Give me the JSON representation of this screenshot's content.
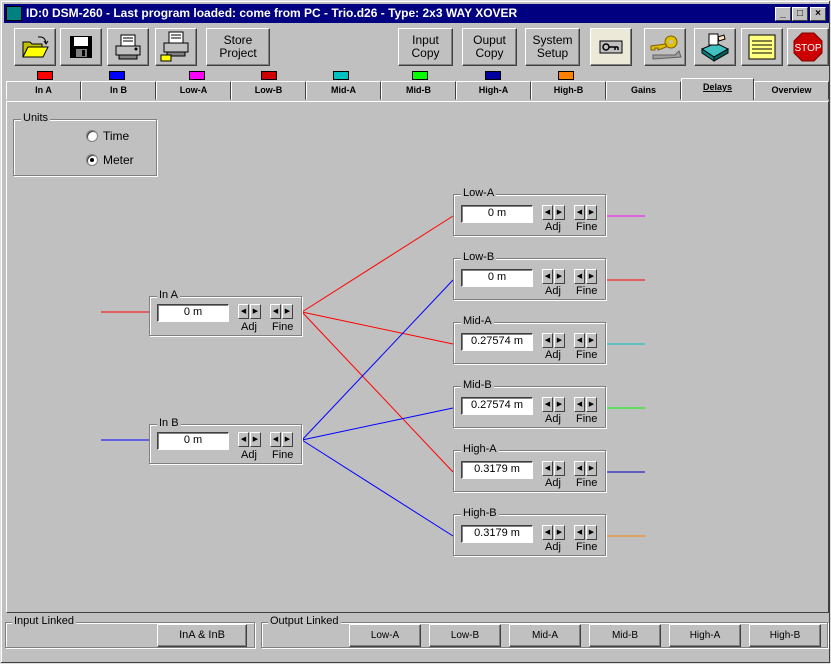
{
  "window": {
    "title": "ID:0 DSM-260 - Last program loaded: come from PC - Trio.d26 - Type: 2x3 WAY XOVER",
    "minimize": "_",
    "maximize": "□",
    "close": "×"
  },
  "toolbar": {
    "store_project": [
      "Store",
      "Project"
    ],
    "input_copy": [
      "Input",
      "Copy"
    ],
    "output_copy": [
      "Ouput",
      "Copy"
    ],
    "system_setup": [
      "System",
      "Setup"
    ],
    "stop_label": "STOP"
  },
  "tabs": [
    {
      "label": "In A",
      "color": "#ff0000"
    },
    {
      "label": "In B",
      "color": "#0000ff"
    },
    {
      "label": "Low-A",
      "color": "#ff00ff"
    },
    {
      "label": "Low-B",
      "color": "#cc0000"
    },
    {
      "label": "Mid-A",
      "color": "#00c0c0"
    },
    {
      "label": "Mid-B",
      "color": "#00ff00"
    },
    {
      "label": "High-A",
      "color": "#0000a0"
    },
    {
      "label": "High-B",
      "color": "#ff8000"
    },
    {
      "label": "Gains",
      "color": ""
    },
    {
      "label": "Delays",
      "color": ""
    },
    {
      "label": "Overview",
      "color": ""
    }
  ],
  "active_tab": "Delays",
  "units": {
    "title": "Units",
    "options": [
      "Time",
      "Meter"
    ],
    "selected": "Meter"
  },
  "delays": {
    "adj_label": "Adj",
    "fine_label": "Fine",
    "inputs": [
      {
        "name": "In A",
        "value": "0 m",
        "color": "#ff0000"
      },
      {
        "name": "In B",
        "value": "0 m",
        "color": "#0000ff"
      }
    ],
    "outputs": [
      {
        "name": "Low-A",
        "value": "0 m",
        "color": "#ff00ff"
      },
      {
        "name": "Low-B",
        "value": "0 m",
        "color": "#ff0000"
      },
      {
        "name": "Mid-A",
        "value": "0.27574 m",
        "color": "#00c0c0"
      },
      {
        "name": "Mid-B",
        "value": "0.27574 m",
        "color": "#00ff00"
      },
      {
        "name": "High-A",
        "value": "0.3179 m",
        "color": "#0000c0"
      },
      {
        "name": "High-B",
        "value": "0.3179 m",
        "color": "#ff8000"
      }
    ]
  },
  "input_linked": {
    "title": "Input Linked",
    "button": "InA & InB"
  },
  "output_linked": {
    "title": "Output Linked",
    "buttons": [
      "Low-A",
      "Low-B",
      "Mid-A",
      "Mid-B",
      "High-A",
      "High-B"
    ]
  }
}
